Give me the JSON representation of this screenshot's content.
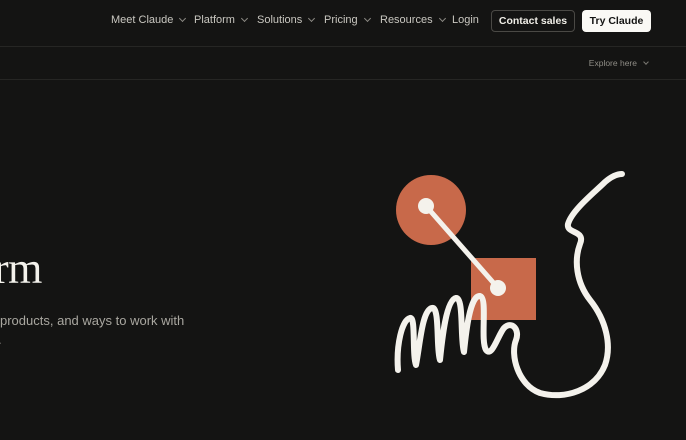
{
  "nav": {
    "items": [
      {
        "label": "Meet Claude",
        "dropdown": true
      },
      {
        "label": "Platform",
        "dropdown": true
      },
      {
        "label": "Solutions",
        "dropdown": true
      },
      {
        "label": "Pricing",
        "dropdown": true
      },
      {
        "label": "Resources",
        "dropdown": true
      },
      {
        "label": "Login",
        "dropdown": false
      }
    ],
    "contact_sales": "Contact sales",
    "try_claude": "Try Claude"
  },
  "subbar": {
    "explore_label": "Explore here"
  },
  "hero": {
    "title_fragment": "rm",
    "subtitle_line1": "products, and ways to work with",
    "subtitle_line2": "."
  },
  "colors": {
    "background": "#141413",
    "accent": "#c8694a",
    "text_primary": "#f4f2ec",
    "button_light": "#faf9f5"
  }
}
